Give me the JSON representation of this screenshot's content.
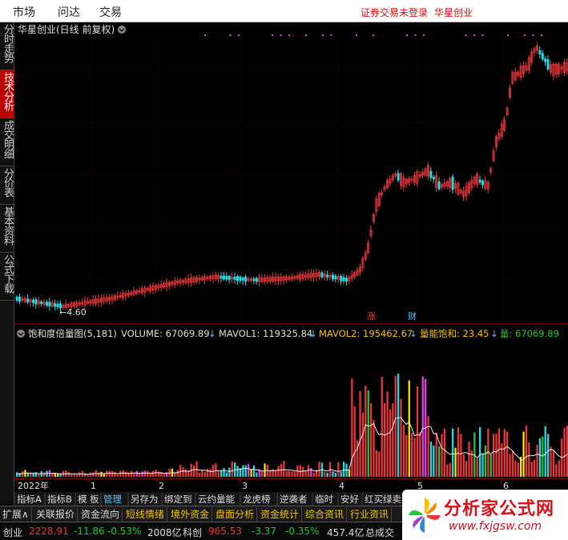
{
  "menu": {
    "market": "市场",
    "ask": "问达",
    "trade": "交易",
    "status": "证券交易未登录",
    "account": "华星创业"
  },
  "side_tabs": [
    "分时走势",
    "技术分析",
    "成交明细",
    "分价表",
    "基本资料",
    "公式下载"
  ],
  "stock": {
    "title": "华星创业(日线 前复权)",
    "low_label": "←4.60"
  },
  "markers": {
    "rise": "涨",
    "finance": "财"
  },
  "indicator": {
    "name": "饱和度倍量图(5,181)",
    "volume": "VOLUME: 67069.89",
    "mavol1": "MAVOL1: 119325.84",
    "mavol2": "MAVOL2: 195462.67",
    "saturation": "量能饱和: 23.45",
    "liang": "量: 67069.89",
    "arrow": "↓"
  },
  "x_axis": [
    "2022年",
    "1",
    "2",
    "3",
    "4",
    "5",
    "6"
  ],
  "bottom_tabs": [
    "扩展∧",
    "关联报价",
    "资金流向",
    "短线情绪",
    "境外资金",
    "盘面分析",
    "资金统计",
    "综合资讯",
    "行业资讯"
  ],
  "indicator_tabs": [
    "指标A",
    "指标B",
    "模 板",
    "管理",
    "另存为",
    "绑定到",
    "云约量能",
    "龙虎榜",
    "逆袭者",
    "临时",
    "安好",
    "红买绿卖"
  ],
  "ticker": {
    "cy_name": "创业",
    "cy_value": "2228.91",
    "cy_change": "-11.86",
    "cy_pct": "-0.53%",
    "cy_amount": "2008亿",
    "kc_name": "科创",
    "kc_value": "965.53",
    "kc_change": "-3.37",
    "kc_pct": "-0.35%",
    "kc_amount": "457.4亿",
    "total_label": "总成交"
  },
  "logo": {
    "title": "分析家公式网",
    "url": "www.fxjgsw.com"
  },
  "colors": {
    "up": "#e8363a",
    "down": "#28d8e0",
    "yellow": "#f5e400",
    "green": "#22c830",
    "magenta": "#e040e0"
  }
}
